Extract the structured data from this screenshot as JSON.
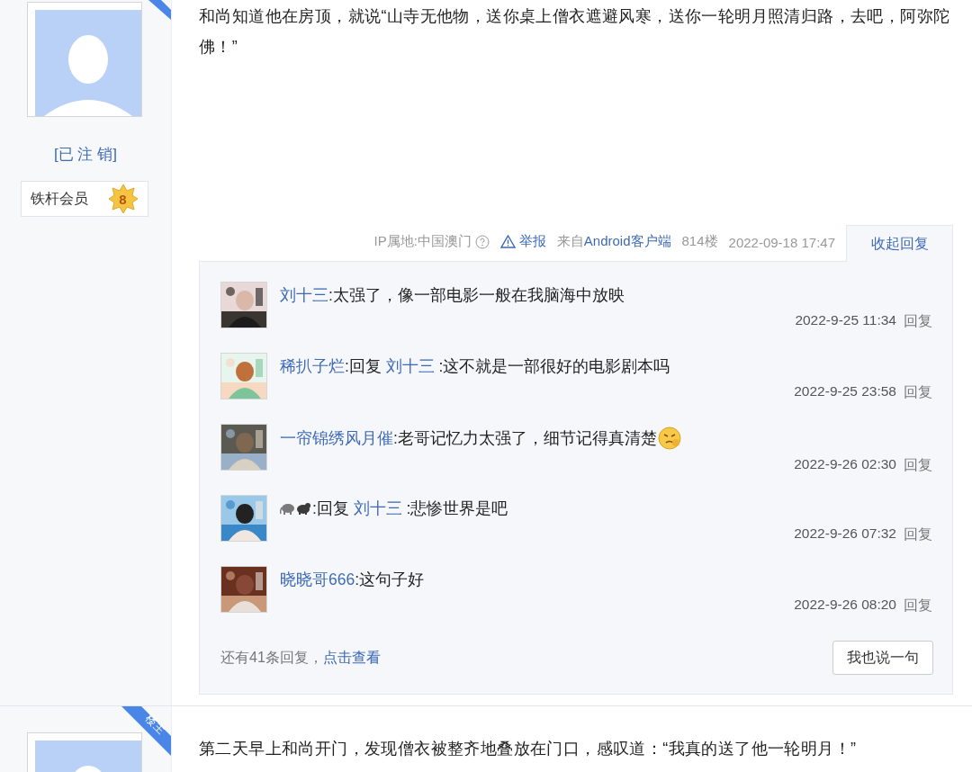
{
  "posts": [
    {
      "author": {
        "name": "[已 注 销]",
        "badge": "铁杆会员",
        "rank": "8"
      },
      "text": "和尚知道他在房顶，就说“山寺无他物，送你桌上僧衣遮避风寒，送你一轮明月照清归路，去吧，阿弥陀佛！”",
      "meta": {
        "ip": "IP属地:中国澳门",
        "report": "举报",
        "source_prefix": "来自",
        "source": "Android客户端",
        "floor": "814楼",
        "time": "2022-09-18 17:47",
        "toggle": "收起回复"
      },
      "replies": {
        "items": [
          {
            "kind": "named",
            "author": "刘十三",
            "separator": ":",
            "segments": [
              {
                "kind": "text",
                "text": "太强了，像一部电影一般在我脑海中放映"
              }
            ],
            "time": "2022-9-25 11:34",
            "reply": "回复"
          },
          {
            "kind": "named",
            "author": "稀扒子烂",
            "separator": ":",
            "segments": [
              {
                "kind": "text",
                "text": "回复 "
              },
              {
                "kind": "link",
                "text": "刘十三"
              },
              {
                "kind": "text",
                "text": " :这不就是一部很好的电影剧本吗"
              }
            ],
            "time": "2022-9-25 23:58",
            "reply": "回复"
          },
          {
            "kind": "named",
            "author": "一帘锦绣风月催",
            "separator": ":",
            "segments": [
              {
                "kind": "text",
                "text": "老哥记忆力太强了，细节记得真清楚"
              },
              {
                "kind": "emoji"
              }
            ],
            "time": "2022-9-26 02:30",
            "reply": "回复"
          },
          {
            "kind": "emoji-name",
            "separator": ":",
            "segments": [
              {
                "kind": "text",
                "text": "回复 "
              },
              {
                "kind": "link",
                "text": "刘十三"
              },
              {
                "kind": "text",
                "text": " :悲惨世界是吧"
              }
            ],
            "time": "2022-9-26 07:32",
            "reply": "回复"
          },
          {
            "kind": "named",
            "author": "晓晓哥666",
            "separator": ":",
            "segments": [
              {
                "kind": "text",
                "text": "这句子好"
              }
            ],
            "time": "2022-9-26 08:20",
            "reply": "回复"
          }
        ],
        "more_prefix": "还有41条回复，",
        "more_link": "点击查看",
        "say_button": "我也说一句"
      }
    },
    {
      "ribbon_label": "楼主",
      "text": "第二天早上和尚开门，发现僧衣被整齐地叠放在门口，感叹道：“我真的送了他一轮明月！”"
    }
  ]
}
